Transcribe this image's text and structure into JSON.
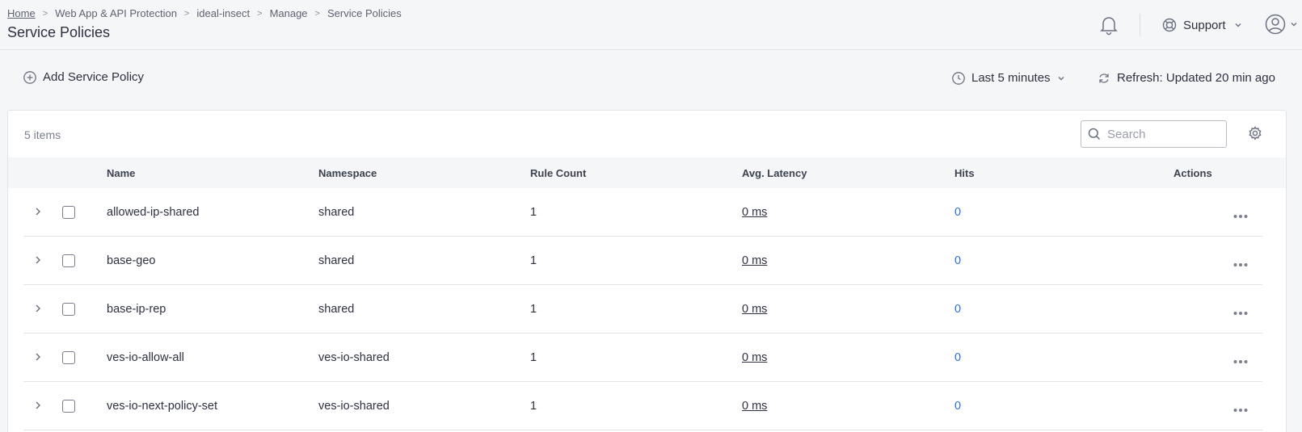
{
  "header": {
    "breadcrumb": [
      "Home",
      "Web App & API Protection",
      "ideal-insect",
      "Manage",
      "Service Policies"
    ],
    "title": "Service Policies",
    "support_label": "Support"
  },
  "toolbar": {
    "add_label": "Add Service Policy",
    "time_range": "Last 5 minutes",
    "refresh_label": "Refresh: Updated 20 min ago"
  },
  "table": {
    "item_count": "5 items",
    "search_placeholder": "Search",
    "columns": [
      "Name",
      "Namespace",
      "Rule Count",
      "Avg. Latency",
      "Hits",
      "Actions"
    ],
    "rows": [
      {
        "name": "allowed-ip-shared",
        "namespace": "shared",
        "rule_count": "1",
        "latency": "0 ms",
        "hits": "0"
      },
      {
        "name": "base-geo",
        "namespace": "shared",
        "rule_count": "1",
        "latency": "0 ms",
        "hits": "0"
      },
      {
        "name": "base-ip-rep",
        "namespace": "shared",
        "rule_count": "1",
        "latency": "0 ms",
        "hits": "0"
      },
      {
        "name": "ves-io-allow-all",
        "namespace": "ves-io-shared",
        "rule_count": "1",
        "latency": "0 ms",
        "hits": "0"
      },
      {
        "name": "ves-io-next-policy-set",
        "namespace": "ves-io-shared",
        "rule_count": "1",
        "latency": "0 ms",
        "hits": "0"
      }
    ]
  },
  "icons": {
    "bell": "bell-icon",
    "support": "lifebuoy-icon",
    "user": "user-circle-icon",
    "add": "plus-circle-icon",
    "clock": "clock-icon",
    "refresh": "refresh-icon",
    "search": "search-icon",
    "settings": "gear-icon",
    "expand": "chevron-right-icon",
    "actions": "more-horizontal-icon"
  },
  "colors": {
    "link_blue": "#2f6fdb",
    "page_bg": "#f5f6f8",
    "text": "#2d3140"
  }
}
